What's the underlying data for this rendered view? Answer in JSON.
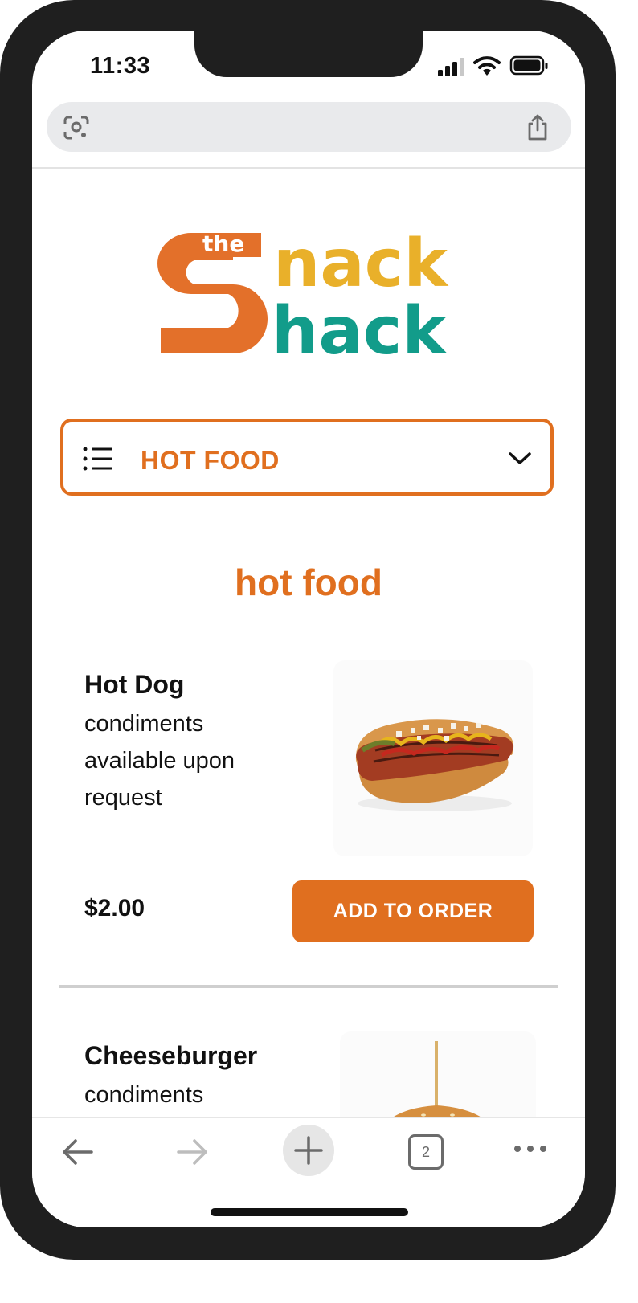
{
  "status_bar": {
    "time": "11:33"
  },
  "browser": {
    "tabs_count": "2"
  },
  "logo": {
    "word_the": "the",
    "word_nack": "nack",
    "word_hack": "hack"
  },
  "category_dropdown": {
    "selected": "HOT FOOD"
  },
  "section": {
    "title": "hot food"
  },
  "items": [
    {
      "name": "Hot Dog",
      "description": "condiments available upon request",
      "price": "$2.00",
      "button": "ADD TO ORDER"
    },
    {
      "name": "Cheeseburger",
      "description": "condiments"
    }
  ],
  "colors": {
    "accent": "#e06f1f",
    "logo_orange": "#e3702a",
    "logo_yellow": "#e9b02a",
    "logo_teal": "#129c8a"
  }
}
